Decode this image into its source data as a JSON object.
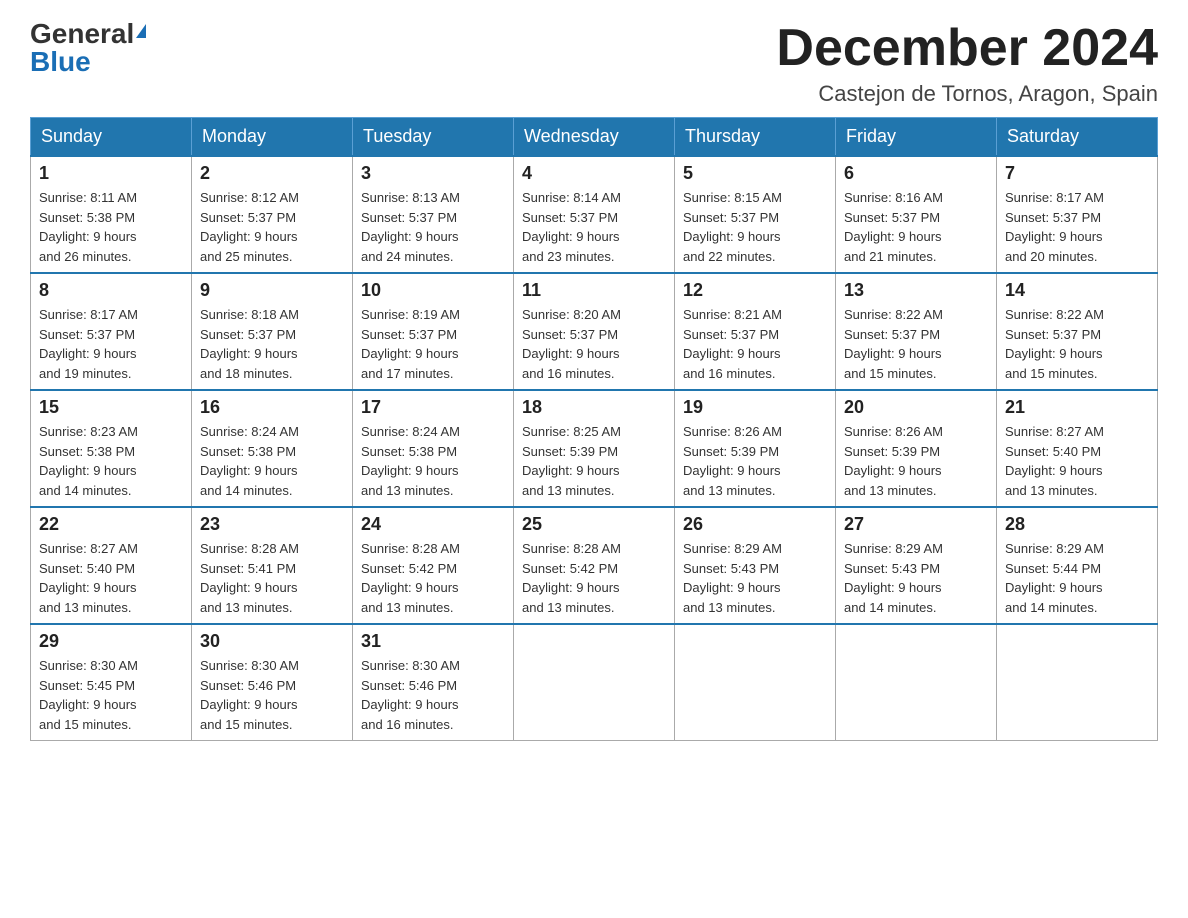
{
  "logo": {
    "general": "General",
    "blue": "Blue",
    "triangle": "▶"
  },
  "title": {
    "month": "December 2024",
    "location": "Castejon de Tornos, Aragon, Spain"
  },
  "headers": [
    "Sunday",
    "Monday",
    "Tuesday",
    "Wednesday",
    "Thursday",
    "Friday",
    "Saturday"
  ],
  "weeks": [
    [
      {
        "day": "1",
        "sunrise": "8:11 AM",
        "sunset": "5:38 PM",
        "daylight": "9 hours and 26 minutes."
      },
      {
        "day": "2",
        "sunrise": "8:12 AM",
        "sunset": "5:37 PM",
        "daylight": "9 hours and 25 minutes."
      },
      {
        "day": "3",
        "sunrise": "8:13 AM",
        "sunset": "5:37 PM",
        "daylight": "9 hours and 24 minutes."
      },
      {
        "day": "4",
        "sunrise": "8:14 AM",
        "sunset": "5:37 PM",
        "daylight": "9 hours and 23 minutes."
      },
      {
        "day": "5",
        "sunrise": "8:15 AM",
        "sunset": "5:37 PM",
        "daylight": "9 hours and 22 minutes."
      },
      {
        "day": "6",
        "sunrise": "8:16 AM",
        "sunset": "5:37 PM",
        "daylight": "9 hours and 21 minutes."
      },
      {
        "day": "7",
        "sunrise": "8:17 AM",
        "sunset": "5:37 PM",
        "daylight": "9 hours and 20 minutes."
      }
    ],
    [
      {
        "day": "8",
        "sunrise": "8:17 AM",
        "sunset": "5:37 PM",
        "daylight": "9 hours and 19 minutes."
      },
      {
        "day": "9",
        "sunrise": "8:18 AM",
        "sunset": "5:37 PM",
        "daylight": "9 hours and 18 minutes."
      },
      {
        "day": "10",
        "sunrise": "8:19 AM",
        "sunset": "5:37 PM",
        "daylight": "9 hours and 17 minutes."
      },
      {
        "day": "11",
        "sunrise": "8:20 AM",
        "sunset": "5:37 PM",
        "daylight": "9 hours and 16 minutes."
      },
      {
        "day": "12",
        "sunrise": "8:21 AM",
        "sunset": "5:37 PM",
        "daylight": "9 hours and 16 minutes."
      },
      {
        "day": "13",
        "sunrise": "8:22 AM",
        "sunset": "5:37 PM",
        "daylight": "9 hours and 15 minutes."
      },
      {
        "day": "14",
        "sunrise": "8:22 AM",
        "sunset": "5:37 PM",
        "daylight": "9 hours and 15 minutes."
      }
    ],
    [
      {
        "day": "15",
        "sunrise": "8:23 AM",
        "sunset": "5:38 PM",
        "daylight": "9 hours and 14 minutes."
      },
      {
        "day": "16",
        "sunrise": "8:24 AM",
        "sunset": "5:38 PM",
        "daylight": "9 hours and 14 minutes."
      },
      {
        "day": "17",
        "sunrise": "8:24 AM",
        "sunset": "5:38 PM",
        "daylight": "9 hours and 13 minutes."
      },
      {
        "day": "18",
        "sunrise": "8:25 AM",
        "sunset": "5:39 PM",
        "daylight": "9 hours and 13 minutes."
      },
      {
        "day": "19",
        "sunrise": "8:26 AM",
        "sunset": "5:39 PM",
        "daylight": "9 hours and 13 minutes."
      },
      {
        "day": "20",
        "sunrise": "8:26 AM",
        "sunset": "5:39 PM",
        "daylight": "9 hours and 13 minutes."
      },
      {
        "day": "21",
        "sunrise": "8:27 AM",
        "sunset": "5:40 PM",
        "daylight": "9 hours and 13 minutes."
      }
    ],
    [
      {
        "day": "22",
        "sunrise": "8:27 AM",
        "sunset": "5:40 PM",
        "daylight": "9 hours and 13 minutes."
      },
      {
        "day": "23",
        "sunrise": "8:28 AM",
        "sunset": "5:41 PM",
        "daylight": "9 hours and 13 minutes."
      },
      {
        "day": "24",
        "sunrise": "8:28 AM",
        "sunset": "5:42 PM",
        "daylight": "9 hours and 13 minutes."
      },
      {
        "day": "25",
        "sunrise": "8:28 AM",
        "sunset": "5:42 PM",
        "daylight": "9 hours and 13 minutes."
      },
      {
        "day": "26",
        "sunrise": "8:29 AM",
        "sunset": "5:43 PM",
        "daylight": "9 hours and 13 minutes."
      },
      {
        "day": "27",
        "sunrise": "8:29 AM",
        "sunset": "5:43 PM",
        "daylight": "9 hours and 14 minutes."
      },
      {
        "day": "28",
        "sunrise": "8:29 AM",
        "sunset": "5:44 PM",
        "daylight": "9 hours and 14 minutes."
      }
    ],
    [
      {
        "day": "29",
        "sunrise": "8:30 AM",
        "sunset": "5:45 PM",
        "daylight": "9 hours and 15 minutes."
      },
      {
        "day": "30",
        "sunrise": "8:30 AM",
        "sunset": "5:46 PM",
        "daylight": "9 hours and 15 minutes."
      },
      {
        "day": "31",
        "sunrise": "8:30 AM",
        "sunset": "5:46 PM",
        "daylight": "9 hours and 16 minutes."
      },
      null,
      null,
      null,
      null
    ]
  ],
  "labels": {
    "sunrise": "Sunrise:",
    "sunset": "Sunset:",
    "daylight": "Daylight:"
  }
}
